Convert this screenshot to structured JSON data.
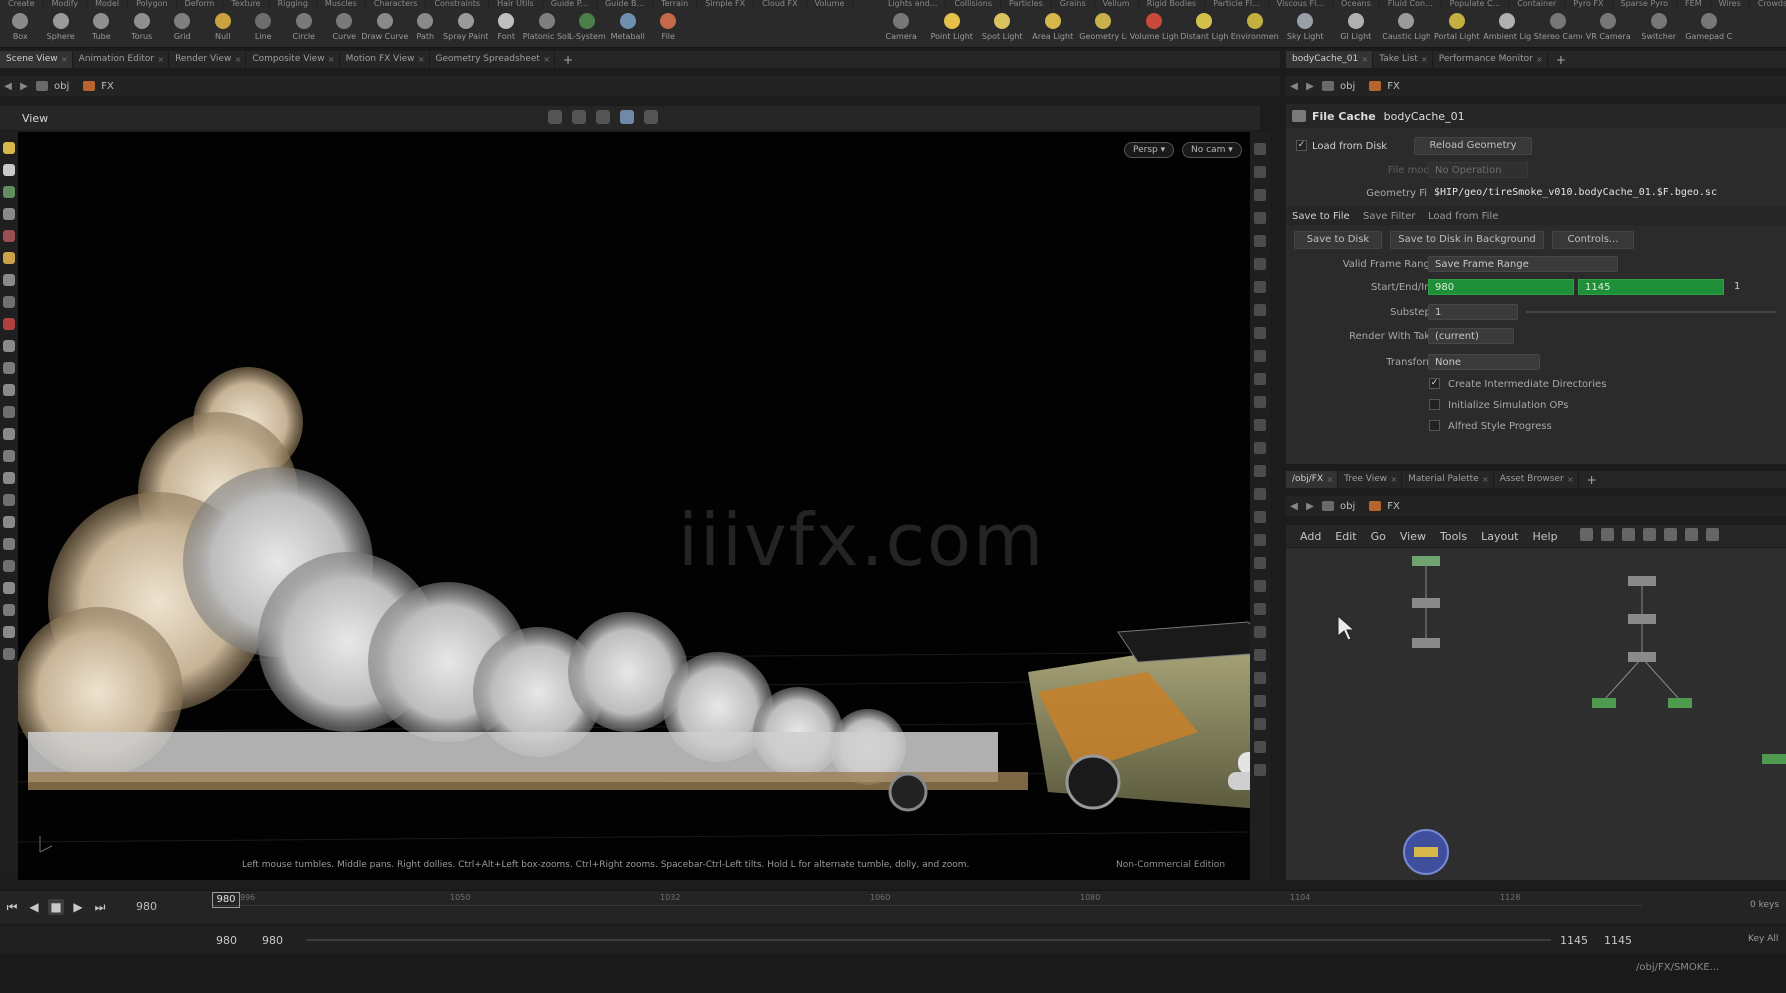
{
  "shelf": {
    "left_tabs": [
      "Create",
      "Modify",
      "Model",
      "Polygon",
      "Deform",
      "Texture",
      "Rigging",
      "Muscles",
      "Characters",
      "Constraints",
      "Hair Utils",
      "Guide P...",
      "Guide B...",
      "Terrain",
      "Simple FX",
      "Cloud FX",
      "Volume"
    ],
    "right_tabs": [
      "Lights and...",
      "Collisions",
      "Particles",
      "Grains",
      "Vellum",
      "Rigid Bodies",
      "Particle Fl...",
      "Viscous Fl...",
      "Oceans",
      "Fluid Con...",
      "Populate C...",
      "Container",
      "Pyro FX",
      "Sparse Pyro",
      "FEM",
      "Wires",
      "Crowds"
    ],
    "left_tools": [
      {
        "label": "Box",
        "icon": "box-icon",
        "color": "#8a8a8a"
      },
      {
        "label": "Sphere",
        "icon": "sphere-icon",
        "color": "#9a9a9a"
      },
      {
        "label": "Tube",
        "icon": "tube-icon",
        "color": "#8f8f8f"
      },
      {
        "label": "Torus",
        "icon": "torus-icon",
        "color": "#8f8f8f"
      },
      {
        "label": "Grid",
        "icon": "grid-icon",
        "color": "#7f7f7f"
      },
      {
        "label": "Null",
        "icon": "null-icon",
        "color": "#c7a23f"
      },
      {
        "label": "Line",
        "icon": "line-icon",
        "color": "#6d6d6d"
      },
      {
        "label": "Circle",
        "icon": "circle-icon",
        "color": "#7a7a7a"
      },
      {
        "label": "Curve",
        "icon": "curve-icon",
        "color": "#7a7a7a"
      },
      {
        "label": "Draw Curve",
        "icon": "draw-curve-icon",
        "color": "#8a8a8a"
      },
      {
        "label": "Path",
        "icon": "path-icon",
        "color": "#8a8a8a"
      },
      {
        "label": "Spray Paint",
        "icon": "spray-paint-icon",
        "color": "#9a9a9a"
      },
      {
        "label": "Font",
        "icon": "font-icon",
        "color": "#c0c0c0"
      },
      {
        "label": "Platonic Solids",
        "icon": "platonic-solids-icon",
        "color": "#7f7f7f"
      },
      {
        "label": "L-System",
        "icon": "l-system-icon",
        "color": "#4a7f4a"
      },
      {
        "label": "Metaball",
        "icon": "metaball-icon",
        "color": "#6f8fb0"
      },
      {
        "label": "File",
        "icon": "file-icon",
        "color": "#c46a4a"
      }
    ],
    "right_tools": [
      {
        "label": "Camera",
        "icon": "camera-icon",
        "color": "#777777"
      },
      {
        "label": "Point Light",
        "icon": "point-light-icon",
        "color": "#e3c14a"
      },
      {
        "label": "Spot Light",
        "icon": "spot-light-icon",
        "color": "#d9c060"
      },
      {
        "label": "Area Light",
        "icon": "area-light-icon",
        "color": "#d4b84c"
      },
      {
        "label": "Geometry Light",
        "icon": "geometry-light-icon",
        "color": "#c9b04a"
      },
      {
        "label": "Volume Light",
        "icon": "volume-light-icon",
        "color": "#c84a3a"
      },
      {
        "label": "Distant Light",
        "icon": "distant-light-icon",
        "color": "#d4c04a"
      },
      {
        "label": "Environment Light",
        "icon": "environment-light-icon",
        "color": "#c4b040"
      },
      {
        "label": "Sky Light",
        "icon": "sky-light-icon",
        "color": "#9aa0a8"
      },
      {
        "label": "GI Light",
        "icon": "gi-light-icon",
        "color": "#b0b0b0"
      },
      {
        "label": "Caustic Light",
        "icon": "caustic-light-icon",
        "color": "#9a9a9a"
      },
      {
        "label": "Portal Light",
        "icon": "portal-light-icon",
        "color": "#c4b040"
      },
      {
        "label": "Ambient Light",
        "icon": "ambient-light-icon",
        "color": "#b0b0b0"
      },
      {
        "label": "Stereo Camera",
        "icon": "stereo-camera-icon",
        "color": "#777777"
      },
      {
        "label": "VR Camera",
        "icon": "vr-camera-icon",
        "color": "#777777"
      },
      {
        "label": "Switcher",
        "icon": "switcher-icon",
        "color": "#777777"
      },
      {
        "label": "Gamepad Camera",
        "icon": "gamepad-camera-icon",
        "color": "#777777"
      }
    ]
  },
  "left_pane": {
    "tabs": [
      "Scene View",
      "Animation Editor",
      "Render View",
      "Composite View",
      "Motion FX View",
      "Geometry Spreadsheet"
    ],
    "active_tab": 0,
    "path": [
      "obj",
      "FX"
    ]
  },
  "viewport": {
    "title": "View",
    "persp_label": "Persp ▾",
    "cam_label": "No cam ▾",
    "hint": "Left mouse tumbles. Middle pans. Right dollies. Ctrl+Alt+Left box-zooms. Ctrl+Right zooms. Spacebar-Ctrl-Left tilts. Hold L for alternate tumble, dolly, and zoom.",
    "edition": "Non-Commercial Edition",
    "watermark": "iiivfx.com"
  },
  "right_pane": {
    "tabs": [
      "bodyCache_01",
      "Take List",
      "Performance Monitor"
    ],
    "active_tab": 0,
    "path": [
      "obj",
      "FX"
    ]
  },
  "params": {
    "node_type": "File Cache",
    "node_name": "bodyCache_01",
    "load_from_disk_label": "Load from Disk",
    "load_from_disk_checked": true,
    "reload_geometry": "Reload Geometry",
    "file_mode_label": "File mode",
    "file_mode_value": "No Operation",
    "geometry_file_label": "Geometry File",
    "geometry_file_value": "$HIP/geo/tireSmoke_v010.bodyCache_01.$F.bgeo.sc",
    "sub_tabs": [
      "Save to File",
      "Save Filter",
      "Load from File"
    ],
    "save_to_disk": "Save to Disk",
    "save_background": "Save to Disk in Background",
    "controls": "Controls...",
    "valid_range_label": "Valid Frame Range",
    "valid_range_value": "Save Frame Range",
    "start_end_label": "Start/End/Inc",
    "start": "980",
    "end": "1145",
    "inc": "1",
    "substeps_label": "Substeps",
    "substeps_value": "1",
    "render_take_label": "Render With Take",
    "render_take_value": "(current)",
    "transform_label": "Transform",
    "transform_value": "None",
    "create_dirs": "Create Intermediate Directories",
    "init_sim": "Initialize Simulation OPs",
    "alfred": "Alfred Style Progress"
  },
  "network_pane": {
    "tabs": [
      "/obj/FX",
      "Tree View",
      "Material Palette",
      "Asset Browser"
    ],
    "active_tab": 0,
    "path": [
      "obj",
      "FX"
    ],
    "menu": [
      "Add",
      "Edit",
      "Go",
      "View",
      "Tools",
      "Layout",
      "Help"
    ]
  },
  "timeline": {
    "current_frame": "980",
    "frame_box": "980",
    "ticks": [
      "996",
      "1050",
      "1032",
      "1060",
      "1080",
      "1104",
      "1128"
    ],
    "keys_label": "0 keys",
    "range_start": "980",
    "range_start2": "980",
    "range_end": "1145",
    "range_end2": "1145",
    "key_all": "Key All"
  },
  "status": {
    "path": "/obj/FX/SMOKE..."
  }
}
